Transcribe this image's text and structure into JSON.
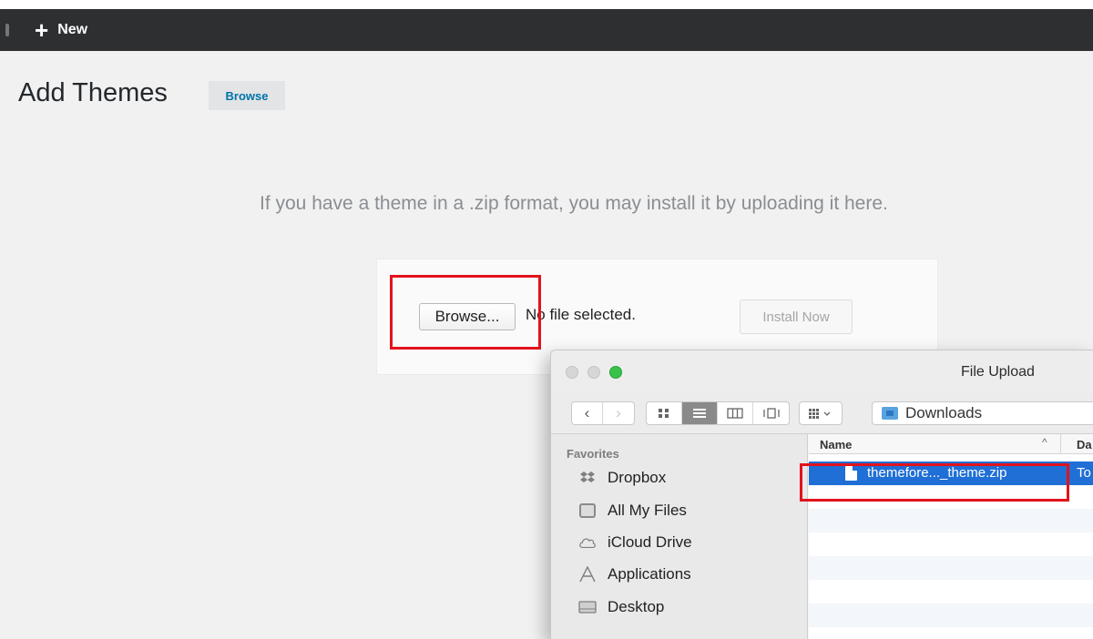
{
  "adminbar": {
    "new_label": "New"
  },
  "page": {
    "title": "Add Themes",
    "browse_tab": "Browse",
    "upload_description": "If you have a theme in a .zip format, you may install it by uploading it here."
  },
  "upload_form": {
    "browse_button": "Browse...",
    "no_file_text": "No file selected.",
    "install_button": "Install Now"
  },
  "dialog": {
    "title": "File Upload",
    "location": "Downloads",
    "nav": {
      "back": "‹",
      "forward": "›"
    },
    "sidebar": {
      "heading": "Favorites",
      "items": [
        {
          "label": "Dropbox",
          "icon": "dropbox-icon"
        },
        {
          "label": "All My Files",
          "icon": "all-files-icon"
        },
        {
          "label": "iCloud Drive",
          "icon": "cloud-icon"
        },
        {
          "label": "Applications",
          "icon": "applications-icon"
        },
        {
          "label": "Desktop",
          "icon": "desktop-icon"
        }
      ]
    },
    "columns": {
      "name": "Name",
      "date": "Da"
    },
    "files": [
      {
        "name": "themefore..._theme.zip",
        "date": "To"
      }
    ]
  },
  "colors": {
    "adminbar_bg": "#2d2f31",
    "accent_blue": "#0073aa",
    "selection_blue": "#1f6fd6",
    "highlight_red": "#e2131c",
    "maximize_green": "#37c249"
  }
}
